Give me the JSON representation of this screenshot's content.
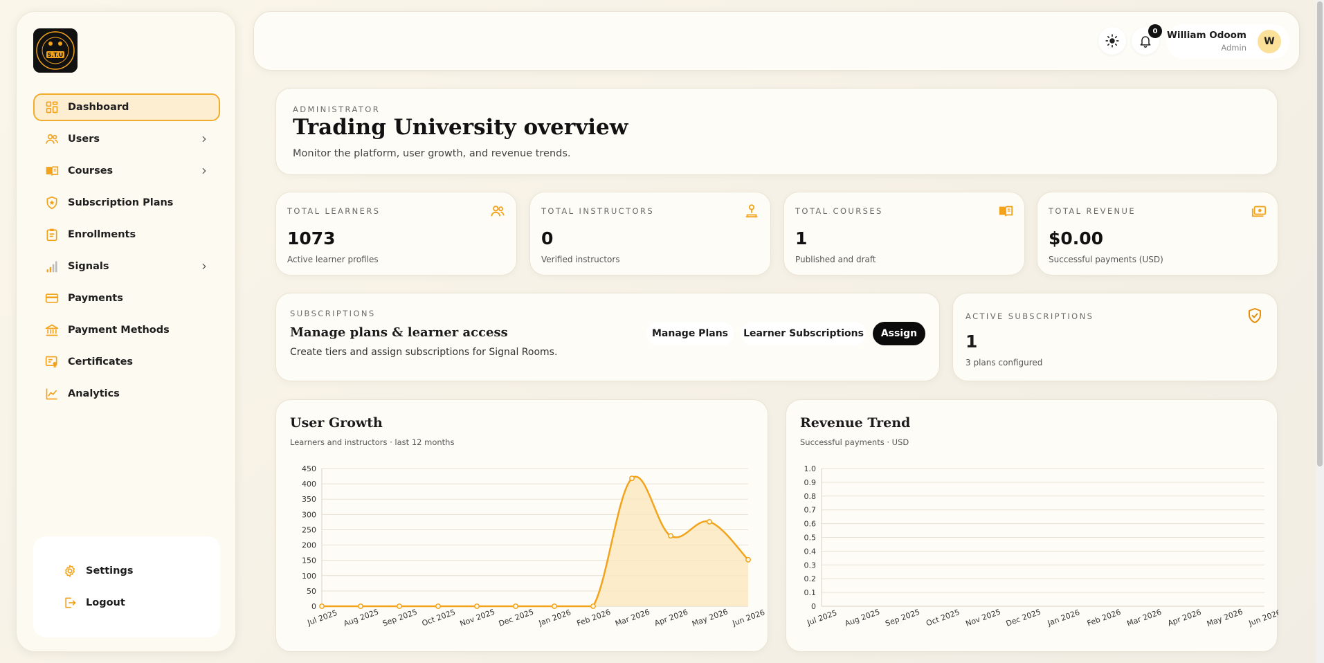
{
  "brand": {
    "logo_text": "S.T.U",
    "logo_ring": "SERENDIPITY TRADING UNIVERSITY"
  },
  "sidebar": {
    "items": [
      {
        "label": "Dashboard",
        "icon": "dashboard-icon",
        "active": true
      },
      {
        "label": "Users",
        "icon": "users-icon",
        "has_chevron": true
      },
      {
        "label": "Courses",
        "icon": "book-icon",
        "has_chevron": true
      },
      {
        "label": "Subscription Plans",
        "icon": "shield-star-icon"
      },
      {
        "label": "Enrollments",
        "icon": "clipboard-icon"
      },
      {
        "label": "Signals",
        "icon": "signal-bars-icon",
        "has_chevron": true
      },
      {
        "label": "Payments",
        "icon": "credit-card-icon"
      },
      {
        "label": "Payment Methods",
        "icon": "bank-icon"
      },
      {
        "label": "Certificates",
        "icon": "certificate-icon"
      },
      {
        "label": "Analytics",
        "icon": "chart-line-icon"
      }
    ],
    "bottom": [
      {
        "label": "Settings",
        "icon": "gear-icon"
      },
      {
        "label": "Logout",
        "icon": "logout-icon"
      }
    ]
  },
  "topbar": {
    "notification_count": "0",
    "user_name": "William Odoom",
    "user_role": "Admin",
    "avatar_initial": "W"
  },
  "hero": {
    "eyebrow": "ADMINISTRATOR",
    "title": "Trading University overview",
    "subtitle": "Monitor the platform, user growth, and revenue trends."
  },
  "stats": [
    {
      "label": "TOTAL LEARNERS",
      "value": "1073",
      "sub": "Active learner profiles",
      "icon": "users-icon"
    },
    {
      "label": "TOTAL INSTRUCTORS",
      "value": "0",
      "sub": "Verified instructors",
      "icon": "instructor-icon"
    },
    {
      "label": "TOTAL COURSES",
      "value": "1",
      "sub": "Published and draft",
      "icon": "book-icon"
    },
    {
      "label": "TOTAL REVENUE",
      "value": "$0.00",
      "sub": "Successful payments (USD)",
      "icon": "money-icon"
    }
  ],
  "subscriptions": {
    "eyebrow": "SUBSCRIPTIONS",
    "title": "Manage plans & learner access",
    "subtitle": "Create tiers and assign subscriptions for Signal Rooms.",
    "buttons": {
      "manage": "Manage Plans",
      "learner": "Learner Subscriptions",
      "assign": "Assign"
    }
  },
  "active_subs": {
    "eyebrow": "ACTIVE SUBSCRIPTIONS",
    "value": "1",
    "sub": "3 plans configured",
    "icon": "shield-check-icon"
  },
  "colors": {
    "accent": "#f2a31b",
    "accent_fill": "#fbe7be",
    "dark": "#0b0b0b"
  },
  "chart_data": [
    {
      "type": "area",
      "title": "User Growth",
      "subtitle": "Learners and instructors · last 12 months",
      "categories": [
        "Jul 2025",
        "Aug 2025",
        "Sep 2025",
        "Oct 2025",
        "Nov 2025",
        "Dec 2025",
        "Jan 2026",
        "Feb 2026",
        "Mar 2026",
        "Apr 2026",
        "May 2026",
        "Jun 2026"
      ],
      "values": [
        0,
        0,
        0,
        0,
        0,
        0,
        0,
        0,
        418,
        230,
        276,
        152
      ],
      "ylim": [
        0,
        450
      ],
      "yticks": [
        "0",
        "50",
        "100",
        "150",
        "200",
        "250",
        "300",
        "350",
        "400",
        "450"
      ],
      "grid": true
    },
    {
      "type": "line",
      "title": "Revenue Trend",
      "subtitle": "Successful payments · USD",
      "categories": [
        "Jul 2025",
        "Aug 2025",
        "Sep 2025",
        "Oct 2025",
        "Nov 2025",
        "Dec 2025",
        "Jan 2026",
        "Feb 2026",
        "Mar 2026",
        "Apr 2026",
        "May 2026",
        "Jun 2026"
      ],
      "values": [],
      "ylim": [
        0,
        1
      ],
      "yticks": [
        "0",
        "0.1",
        "0.2",
        "0.3",
        "0.4",
        "0.5",
        "0.6",
        "0.7",
        "0.8",
        "0.9",
        "1.0"
      ],
      "grid": true
    }
  ]
}
